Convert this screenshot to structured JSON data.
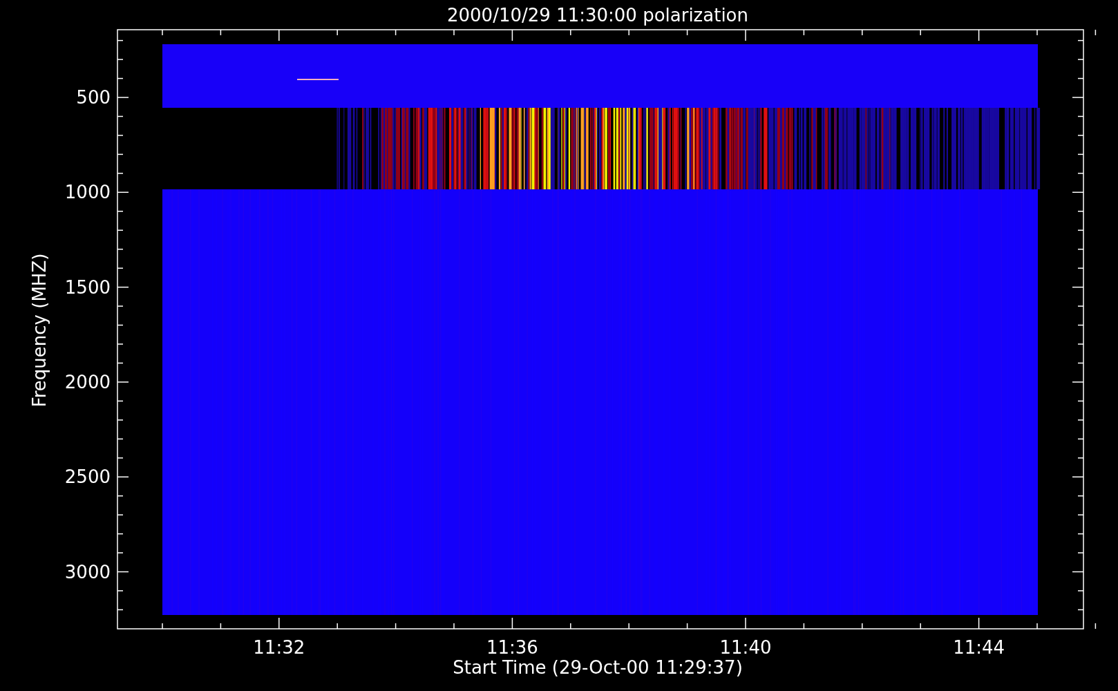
{
  "title": "2000/10/29 11:30:00 polarization",
  "y_axis": {
    "label": "Frequency (MHZ)",
    "tick_labels": [
      "500",
      "1000",
      "1500",
      "2000",
      "2500",
      "3000"
    ]
  },
  "x_axis": {
    "label": "Start Time (29-Oct-00 11:29:37)",
    "tick_labels": [
      "11:32",
      "11:36",
      "11:40",
      "11:44"
    ]
  }
}
